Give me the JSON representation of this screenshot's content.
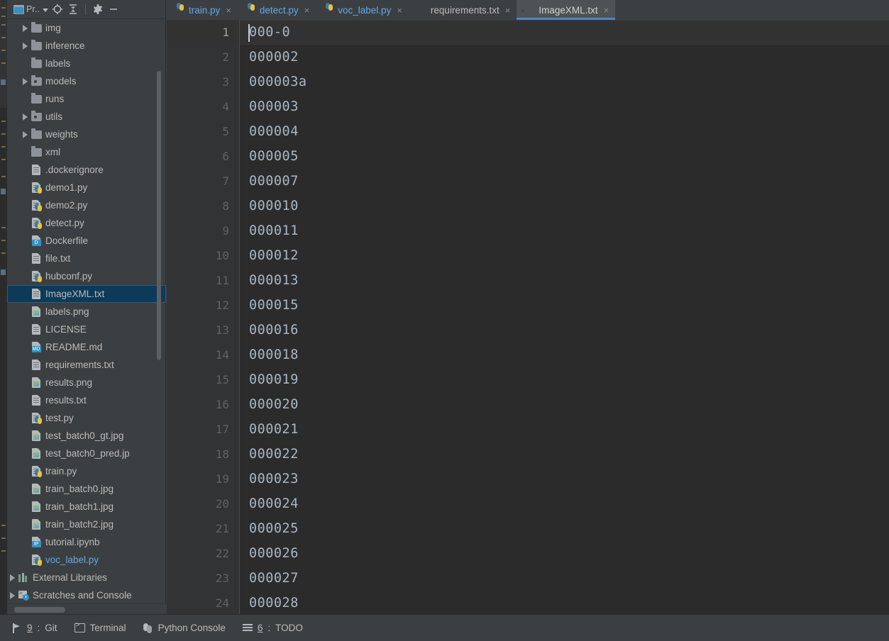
{
  "toolbar": {
    "project_label": "Pr..",
    "project_icon": "project-window-icon",
    "locate_icon": "locate-target-icon",
    "collapse_icon": "collapse-all-icon",
    "settings_icon": "gear-icon",
    "hide_icon": "minimize-icon"
  },
  "sidebar": {
    "items": [
      {
        "label": "img",
        "kind": "folder",
        "arrow": true,
        "indent": 1,
        "selected": false,
        "blue": false
      },
      {
        "label": "inference",
        "kind": "folder",
        "arrow": true,
        "indent": 1,
        "selected": false,
        "blue": false
      },
      {
        "label": "labels",
        "kind": "folder",
        "arrow": false,
        "indent": 1,
        "selected": false,
        "blue": false
      },
      {
        "label": "models",
        "kind": "folder-src",
        "arrow": true,
        "indent": 1,
        "selected": false,
        "blue": false
      },
      {
        "label": "runs",
        "kind": "folder",
        "arrow": false,
        "indent": 1,
        "selected": false,
        "blue": false
      },
      {
        "label": "utils",
        "kind": "folder-src",
        "arrow": true,
        "indent": 1,
        "selected": false,
        "blue": false
      },
      {
        "label": "weights",
        "kind": "folder",
        "arrow": true,
        "indent": 1,
        "selected": false,
        "blue": false
      },
      {
        "label": "xml",
        "kind": "folder",
        "arrow": false,
        "indent": 1,
        "selected": false,
        "blue": false
      },
      {
        "label": ".dockerignore",
        "kind": "file",
        "arrow": false,
        "indent": 1,
        "selected": false,
        "blue": false
      },
      {
        "label": "demo1.py",
        "kind": "python",
        "arrow": false,
        "indent": 1,
        "selected": false,
        "blue": false
      },
      {
        "label": "demo2.py",
        "kind": "python",
        "arrow": false,
        "indent": 1,
        "selected": false,
        "blue": false
      },
      {
        "label": "detect.py",
        "kind": "python",
        "arrow": false,
        "indent": 1,
        "selected": false,
        "blue": false
      },
      {
        "label": "Dockerfile",
        "kind": "tag",
        "tag": "D",
        "arrow": false,
        "indent": 1,
        "selected": false,
        "blue": false
      },
      {
        "label": "file.txt",
        "kind": "file",
        "arrow": false,
        "indent": 1,
        "selected": false,
        "blue": false
      },
      {
        "label": "hubconf.py",
        "kind": "python",
        "arrow": false,
        "indent": 1,
        "selected": false,
        "blue": false
      },
      {
        "label": "ImageXML.txt",
        "kind": "file",
        "arrow": false,
        "indent": 1,
        "selected": true,
        "blue": false
      },
      {
        "label": "labels.png",
        "kind": "image",
        "arrow": false,
        "indent": 1,
        "selected": false,
        "blue": false
      },
      {
        "label": "LICENSE",
        "kind": "file",
        "arrow": false,
        "indent": 1,
        "selected": false,
        "blue": false
      },
      {
        "label": "README.md",
        "kind": "tag",
        "tag": "MD",
        "arrow": false,
        "indent": 1,
        "selected": false,
        "blue": false
      },
      {
        "label": "requirements.txt",
        "kind": "file",
        "arrow": false,
        "indent": 1,
        "selected": false,
        "blue": false
      },
      {
        "label": "results.png",
        "kind": "image",
        "arrow": false,
        "indent": 1,
        "selected": false,
        "blue": false
      },
      {
        "label": "results.txt",
        "kind": "file",
        "arrow": false,
        "indent": 1,
        "selected": false,
        "blue": false
      },
      {
        "label": "test.py",
        "kind": "python",
        "arrow": false,
        "indent": 1,
        "selected": false,
        "blue": false
      },
      {
        "label": "test_batch0_gt.jpg",
        "kind": "image",
        "arrow": false,
        "indent": 1,
        "selected": false,
        "blue": false
      },
      {
        "label": "test_batch0_pred.jp",
        "kind": "image",
        "arrow": false,
        "indent": 1,
        "selected": false,
        "blue": false
      },
      {
        "label": "train.py",
        "kind": "python",
        "arrow": false,
        "indent": 1,
        "selected": false,
        "blue": false
      },
      {
        "label": "train_batch0.jpg",
        "kind": "image",
        "arrow": false,
        "indent": 1,
        "selected": false,
        "blue": false
      },
      {
        "label": "train_batch1.jpg",
        "kind": "image",
        "arrow": false,
        "indent": 1,
        "selected": false,
        "blue": false
      },
      {
        "label": "train_batch2.jpg",
        "kind": "image",
        "arrow": false,
        "indent": 1,
        "selected": false,
        "blue": false
      },
      {
        "label": "tutorial.ipynb",
        "kind": "tag",
        "tag": "IP",
        "arrow": false,
        "indent": 1,
        "selected": false,
        "blue": false
      },
      {
        "label": "voc_label.py",
        "kind": "python",
        "arrow": false,
        "indent": 1,
        "selected": false,
        "blue": true
      },
      {
        "label": "External Libraries",
        "kind": "library",
        "arrow": true,
        "indent": 0,
        "selected": false,
        "blue": false
      },
      {
        "label": "Scratches and Console",
        "kind": "scratch",
        "arrow": true,
        "indent": 0,
        "selected": false,
        "blue": false
      }
    ]
  },
  "tabs": [
    {
      "label": "train.py",
      "kind": "python",
      "active": false
    },
    {
      "label": "detect.py",
      "kind": "python",
      "active": false
    },
    {
      "label": "voc_label.py",
      "kind": "python",
      "active": false
    },
    {
      "label": "requirements.txt",
      "kind": "file",
      "active": false
    },
    {
      "label": "ImageXML.txt",
      "kind": "file",
      "active": true
    }
  ],
  "tab_close_glyph": "×",
  "editor": {
    "active_line": 1,
    "lines": [
      {
        "n": "1",
        "text": "000-0"
      },
      {
        "n": "2",
        "text": "000002"
      },
      {
        "n": "3",
        "text": "000003a"
      },
      {
        "n": "4",
        "text": "000003"
      },
      {
        "n": "5",
        "text": "000004"
      },
      {
        "n": "6",
        "text": "000005"
      },
      {
        "n": "7",
        "text": "000007"
      },
      {
        "n": "8",
        "text": "000010"
      },
      {
        "n": "9",
        "text": "000011"
      },
      {
        "n": "10",
        "text": "000012"
      },
      {
        "n": "11",
        "text": "000013"
      },
      {
        "n": "12",
        "text": "000015"
      },
      {
        "n": "13",
        "text": "000016"
      },
      {
        "n": "14",
        "text": "000018"
      },
      {
        "n": "15",
        "text": "000019"
      },
      {
        "n": "16",
        "text": "000020"
      },
      {
        "n": "17",
        "text": "000021"
      },
      {
        "n": "18",
        "text": "000022"
      },
      {
        "n": "19",
        "text": "000023"
      },
      {
        "n": "20",
        "text": "000024"
      },
      {
        "n": "21",
        "text": "000025"
      },
      {
        "n": "22",
        "text": "000026"
      },
      {
        "n": "23",
        "text": "000027"
      },
      {
        "n": "24",
        "text": "000028"
      }
    ]
  },
  "statusbar": {
    "items": [
      {
        "mnemonic": "9",
        "sep": ": ",
        "label": "Git",
        "icon": "git-branch-icon"
      },
      {
        "mnemonic": "",
        "sep": "",
        "label": "Terminal",
        "icon": "terminal-icon"
      },
      {
        "mnemonic": "",
        "sep": "",
        "label": "Python Console",
        "icon": "python-console-icon"
      },
      {
        "mnemonic": "6",
        "sep": ": ",
        "label": "TODO",
        "icon": "todo-list-icon"
      }
    ]
  },
  "colors": {
    "panel_bg": "#3c3f41",
    "editor_bg": "#2b2b2b",
    "gutter_bg": "#313335",
    "selection_bg": "#0d3a58",
    "accent_blue": "#4a88c7",
    "text": "#bbbbbb",
    "code_text": "#a9b7c6",
    "link_blue": "#62a8ea"
  }
}
